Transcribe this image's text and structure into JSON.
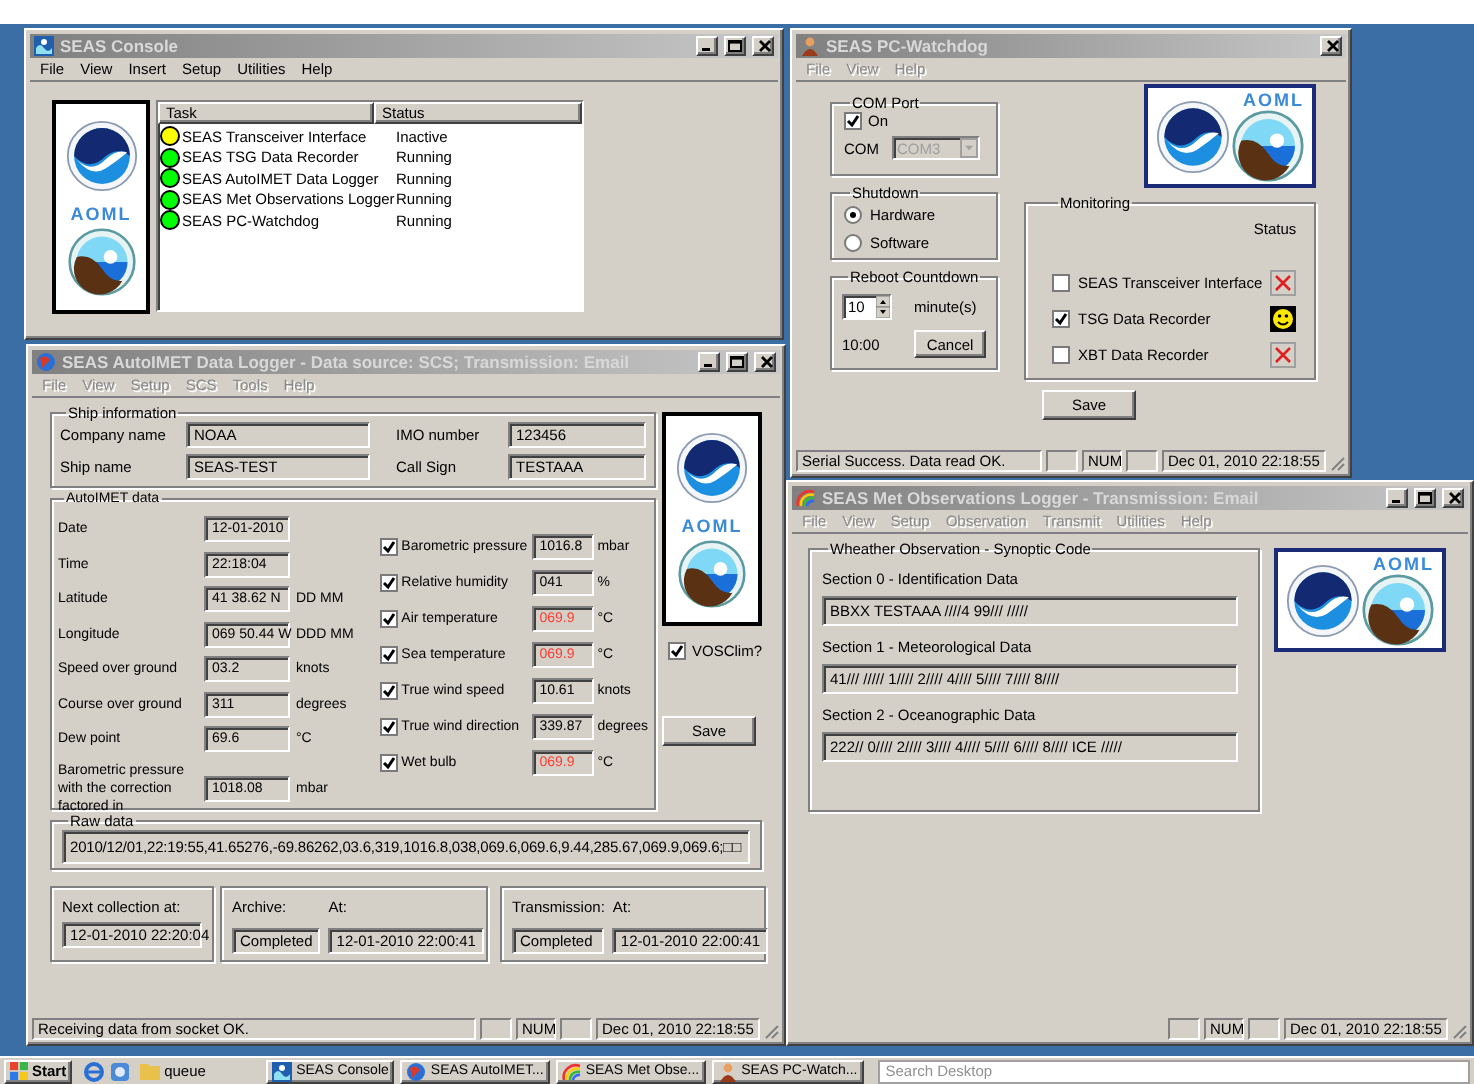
{
  "console": {
    "title": "SEAS Console",
    "menu": [
      "File",
      "View",
      "Insert",
      "Setup",
      "Utilities",
      "Help"
    ],
    "menu_disabled": false,
    "logo_label": "AOML",
    "columns": [
      "Task",
      "Status"
    ],
    "tasks": [
      {
        "name": "SEAS Transceiver Interface",
        "status": "Inactive",
        "color": "#ffff00"
      },
      {
        "name": "SEAS TSG Data Recorder",
        "status": "Running",
        "color": "#00ff00"
      },
      {
        "name": "SEAS AutoIMET Data Logger",
        "status": "Running",
        "color": "#00ff00"
      },
      {
        "name": "SEAS Met Observations Logger",
        "status": "Running",
        "color": "#00ff00"
      },
      {
        "name": "SEAS PC-Watchdog",
        "status": "Running",
        "color": "#00ff00"
      }
    ]
  },
  "watchdog": {
    "title": "SEAS PC-Watchdog",
    "menu": [
      "File",
      "View",
      "Help"
    ],
    "menu_disabled": true,
    "logo_label": "AOML",
    "com_port": {
      "legend": "COM Port",
      "on_label": "On",
      "checked": true,
      "com_label": "COM",
      "com_value": "COM3",
      "disabled": true
    },
    "shutdown": {
      "legend": "Shutdown",
      "options": [
        {
          "label": "Hardware",
          "selected": true
        },
        {
          "label": "Software",
          "selected": false
        }
      ]
    },
    "reboot": {
      "legend": "Reboot Countdown",
      "value": "10",
      "unit": "minute(s)",
      "time": "10:00",
      "button": "Cancel"
    },
    "monitoring": {
      "legend": "Monitoring",
      "status_heading": "Status",
      "items": [
        {
          "label": "SEAS Transceiver Interface",
          "checked": false,
          "kind": "error"
        },
        {
          "label": "TSG Data Recorder",
          "checked": true,
          "kind": "ok"
        },
        {
          "label": "XBT Data Recorder",
          "checked": false,
          "kind": "error"
        }
      ]
    },
    "save": "Save",
    "status_bar": {
      "message": "Serial Success. Data read OK.",
      "num": "NUM",
      "datetime": "Dec 01, 2010 22:18:55"
    }
  },
  "autoimet": {
    "title": "SEAS AutoIMET Data Logger - Data source: SCS; Transmission: Email",
    "menu": [
      "File",
      "View",
      "Setup",
      "SCS",
      "Tools",
      "Help"
    ],
    "menu_disabled": true,
    "logo_label": "AOML",
    "ship_info": {
      "legend": "Ship information",
      "fields": [
        {
          "label": "Company name",
          "value": "NOAA"
        },
        {
          "label": "IMO number",
          "value": "123456"
        },
        {
          "label": "Ship name",
          "value": "SEAS-TEST"
        },
        {
          "label": "Call Sign",
          "value": "TESTAAA"
        }
      ]
    },
    "data": {
      "legend": "AutoIMET data",
      "left": [
        {
          "label": "Date",
          "value": "12-01-2010"
        },
        {
          "label": "Time",
          "value": "22:18:04"
        },
        {
          "label": "Latitude",
          "value": "41 38.62 N",
          "unit": "DD MM"
        },
        {
          "label": "Longitude",
          "value": "069 50.44 W",
          "unit": "DDD MM"
        },
        {
          "label": "Speed over ground",
          "value": "03.2",
          "unit": "knots"
        },
        {
          "label": "Course over ground",
          "value": "311",
          "unit": "degrees"
        },
        {
          "label": "Dew point",
          "value": "69.6",
          "unit": "°C"
        },
        {
          "label": "Barometric pressure with the correction factored in",
          "value": "1018.08",
          "unit": "mbar"
        }
      ],
      "right": [
        {
          "label": "Barometric pressure",
          "checked": true,
          "value": "1016.8",
          "unit": "mbar",
          "flagged": false
        },
        {
          "label": "Relative humidity",
          "checked": true,
          "value": "041",
          "unit": "%",
          "flagged": false
        },
        {
          "label": "Air temperature",
          "checked": true,
          "value": "069.9",
          "unit": "°C",
          "flagged": true
        },
        {
          "label": "Sea temperature",
          "checked": true,
          "value": "069.9",
          "unit": "°C",
          "flagged": true
        },
        {
          "label": "True wind speed",
          "checked": true,
          "value": "10.61",
          "unit": "knots",
          "flagged": false
        },
        {
          "label": "True wind direction",
          "checked": true,
          "value": "339.87",
          "unit": "degrees",
          "flagged": false
        },
        {
          "label": "Wet bulb",
          "checked": true,
          "value": "069.9",
          "unit": "°C",
          "flagged": true
        }
      ]
    },
    "vosclim": {
      "label": "VOSClim?",
      "checked": true
    },
    "save": "Save",
    "raw": {
      "legend": "Raw data",
      "value": "2010/12/01,22:19:55,41.65276,-69.86262,03.6,319,1016.8,038,069.6,069.6,9.44,285.67,069.9,069.6;□□"
    },
    "next": {
      "label": "Next collection at:",
      "value": "12-01-2010 22:20:04"
    },
    "archive": {
      "label": "Archive:",
      "status": "Completed",
      "at_label": "At:",
      "at": "12-01-2010 22:00:41"
    },
    "transmission": {
      "label": "Transmission:",
      "status": "Completed",
      "at_label": "At:",
      "at": "12-01-2010 22:00:41"
    },
    "status_bar": {
      "message": "Receiving data from socket OK.",
      "num": "NUM",
      "datetime": "Dec 01, 2010 22:18:55"
    }
  },
  "met_obs": {
    "title": "SEAS Met Observations Logger - Transmission: Email",
    "menu": [
      "File",
      "View",
      "Setup",
      "Observation",
      "Transmit",
      "Utilities",
      "Help"
    ],
    "menu_disabled": true,
    "logo_label": "AOML",
    "legend": "Wheather Observation - Synoptic Code",
    "sections": [
      {
        "label": "Section 0 - Identification Data",
        "code": "BBXX TESTAAA ////4 99/// /////"
      },
      {
        "label": "Section 1 - Meteorological Data",
        "code": "41/// ///// 1//// 2//// 4//// 5//// 7//// 8////"
      },
      {
        "label": "Section 2 - Oceanographic Data",
        "code": "222// 0//// 2//// 3//// 4//// 5//// 6//// 8//// ICE /////"
      }
    ],
    "status_bar": {
      "num": "NUM",
      "datetime": "Dec 01, 2010 22:18:55"
    }
  },
  "taskbar": {
    "start": "Start",
    "folder_button": "queue",
    "buttons": [
      {
        "label": "SEAS Console",
        "kind": "console"
      },
      {
        "label": "SEAS AutoIMET...",
        "kind": "autoimet"
      },
      {
        "label": "SEAS Met Obse...",
        "kind": "metobs"
      },
      {
        "label": "SEAS PC-Watch...",
        "kind": "watchdog"
      }
    ],
    "search_placeholder": "Search Desktop"
  }
}
